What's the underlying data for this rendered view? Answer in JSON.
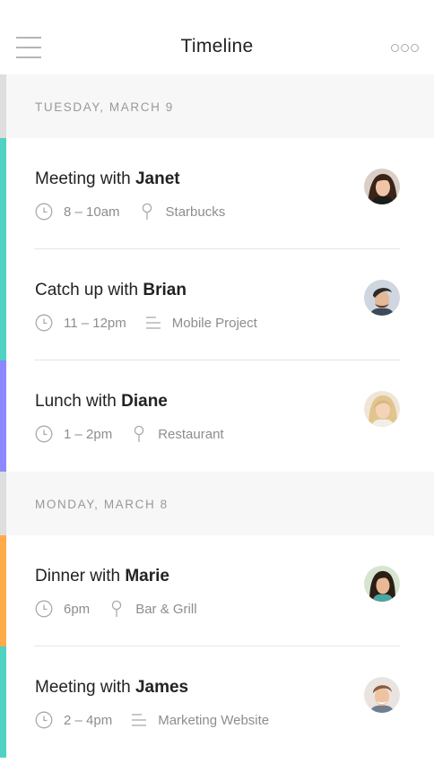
{
  "header": {
    "title": "Timeline",
    "menu_icon": "hamburger-icon",
    "more_icon": "more-dots-icon"
  },
  "days": [
    {
      "label": "TUESDAY, MARCH 9",
      "events": [
        {
          "title_prefix": "Meeting with",
          "person": "Janet",
          "time": "8 – 10am",
          "location_icon": "pin-icon",
          "location": "Starbucks",
          "accent": "#50d2c2"
        },
        {
          "title_prefix": "Catch up with",
          "person": "Brian",
          "time": "11 – 12pm",
          "location_icon": "lines-icon",
          "location": "Mobile Project",
          "accent": "#50d2c2"
        },
        {
          "title_prefix": "Lunch with",
          "person": "Diane",
          "time": "1 – 2pm",
          "location_icon": "pin-icon",
          "location": "Restaurant",
          "accent": "#8c88ff"
        }
      ]
    },
    {
      "label": "MONDAY, MARCH 8",
      "events": [
        {
          "title_prefix": "Dinner with",
          "person": "Marie",
          "time": "6pm",
          "location_icon": "pin-icon",
          "location": "Bar & Grill",
          "accent": "#ffab4a"
        },
        {
          "title_prefix": "Meeting with",
          "person": "James",
          "time": "2 – 4pm",
          "location_icon": "lines-icon",
          "location": "Marketing Website",
          "accent": "#50d2c2"
        }
      ]
    }
  ]
}
